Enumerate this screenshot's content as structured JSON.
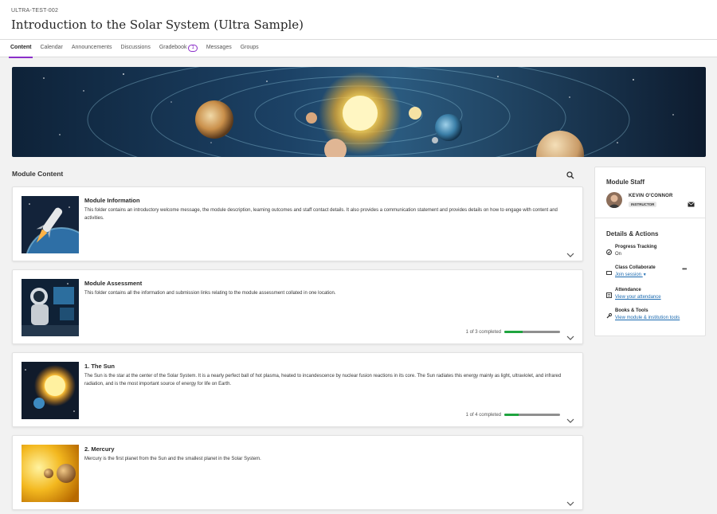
{
  "course": {
    "code": "ULTRA-TEST-002",
    "title": "Introduction to the Solar System (Ultra Sample)"
  },
  "tabs": [
    {
      "label": "Content",
      "active": true
    },
    {
      "label": "Calendar"
    },
    {
      "label": "Announcements"
    },
    {
      "label": "Discussions"
    },
    {
      "label": "Gradebook",
      "badge": "1"
    },
    {
      "label": "Messages"
    },
    {
      "label": "Groups"
    }
  ],
  "module": {
    "heading": "Module Content",
    "search_icon": "search-icon",
    "items": [
      {
        "title": "Module Information",
        "description": "This folder contains an introductory welcome message, the module description, learning outcomes and staff contact details. It also provides a communication statement and provides details on how to engage with content and activities.",
        "thumb": "rocket-launch",
        "progress_text": null
      },
      {
        "title": "Module Assessment",
        "description": "This folder contains all the information and submission links relating to the module assessment collated in one location.",
        "thumb": "astronaut-at-computer",
        "progress_text": "1 of 3 completed",
        "progress": 0.33
      },
      {
        "title": "1. The Sun",
        "description": "The Sun is the star at the center of the Solar System. It is a nearly perfect ball of hot plasma, heated to incandescence by nuclear fusion reactions in its core. The Sun radiates this energy mainly as light, ultraviolet, and infrared radiation, and is the most important source of energy for life on Earth.",
        "thumb": "sun-and-earth",
        "progress_text": "1 of 4 completed",
        "progress": 0.25
      },
      {
        "title": "2. Mercury",
        "description": "Mercury is the first planet from the Sun and the smallest planet in the Solar System.",
        "thumb": "mercury",
        "progress_text": null
      }
    ]
  },
  "sidebar": {
    "staff_heading": "Module Staff",
    "staff_name": "KEVIN O'CONNOR",
    "staff_role": "INSTRUCTOR",
    "details_heading": "Details & Actions",
    "actions": {
      "progress": {
        "label": "Progress Tracking",
        "value": "On",
        "icon": "check-circle-icon"
      },
      "collaborate": {
        "label": "Class Collaborate",
        "link": "Join session",
        "icon": "video-icon"
      },
      "attendance": {
        "label": "Attendance",
        "link": "View your attendance",
        "icon": "attendance-icon"
      },
      "books": {
        "label": "Books & Tools",
        "link": "View module & institution tools",
        "icon": "wrench-icon"
      }
    }
  },
  "colors": {
    "accent": "#8b2fc9",
    "progress_green": "#1fa43f",
    "link": "#1b6ab0"
  }
}
